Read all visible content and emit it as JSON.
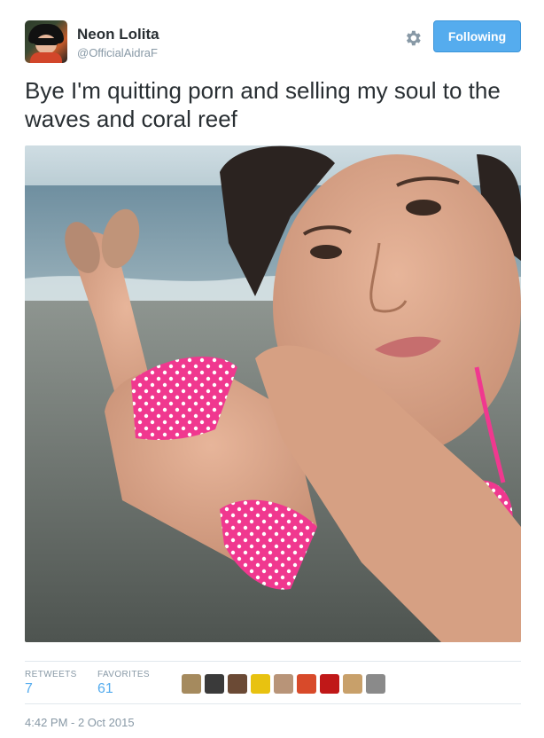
{
  "user": {
    "name": "Neon Lolita",
    "handle": "@OfficialAidraF"
  },
  "actions": {
    "settings_icon": "gear-icon",
    "follow_label": "Following"
  },
  "tweet": {
    "text": "Bye I'm quitting porn and selling my soul to the waves and coral reef"
  },
  "stats": {
    "retweets_label": "RETWEETS",
    "retweets_value": "7",
    "favorites_label": "FAVORITES",
    "favorites_value": "61"
  },
  "favoriters": [
    {
      "name": "favoriter-avatar-1",
      "color": "#a58a5e"
    },
    {
      "name": "favoriter-avatar-2",
      "color": "#3a3a3a"
    },
    {
      "name": "favoriter-avatar-3",
      "color": "#6b4a35"
    },
    {
      "name": "favoriter-avatar-4",
      "color": "#e8c210"
    },
    {
      "name": "favoriter-avatar-5",
      "color": "#b89478"
    },
    {
      "name": "favoriter-avatar-6",
      "color": "#d84a2a"
    },
    {
      "name": "favoriter-avatar-7",
      "color": "#c01818"
    },
    {
      "name": "favoriter-avatar-8",
      "color": "#c8a06a"
    },
    {
      "name": "favoriter-avatar-9",
      "color": "#8a8a8a"
    }
  ],
  "timestamp": "4:42 PM - 2 Oct 2015",
  "colors": {
    "accent": "#55acee",
    "text": "#292f33",
    "muted": "#8899a6"
  }
}
